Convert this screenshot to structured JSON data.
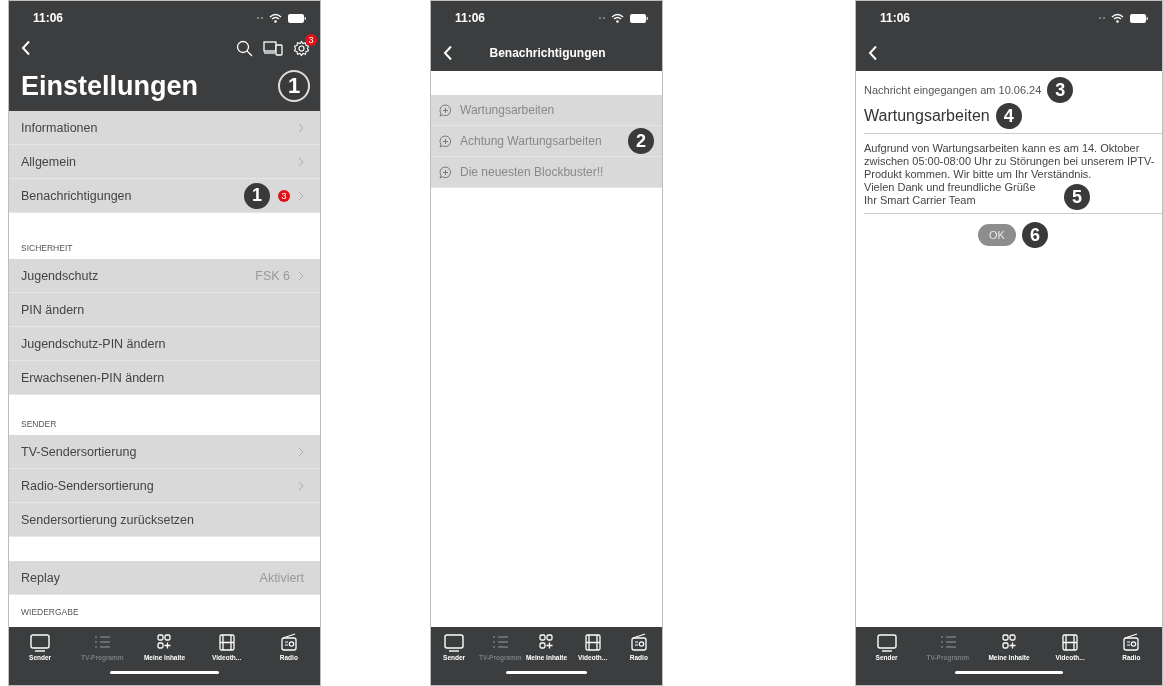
{
  "screens": [
    {
      "kind": "settings",
      "status_bar": {
        "time": "11:06"
      },
      "title": "Einstellungen",
      "title_callout": "1",
      "settings_badge": "3",
      "sections": [
        {
          "rows": [
            {
              "label": "Informationen",
              "chevron": true
            },
            {
              "label": "Allgemein",
              "chevron": true
            },
            {
              "label": "Benachrichtigungen",
              "badge": "3",
              "callout": "1",
              "chevron": true
            }
          ]
        },
        {
          "header": "SICHERHEIT",
          "rows": [
            {
              "label": "Jugendschutz",
              "value": "FSK 6",
              "chevron": true
            },
            {
              "label": "PIN ändern",
              "chevron": false
            },
            {
              "label": "Jugendschutz-PIN ändern",
              "chevron": false
            },
            {
              "label": "Erwachsenen-PIN ändern",
              "chevron": false
            }
          ]
        },
        {
          "header": "SENDER",
          "rows": [
            {
              "label": "TV-Sendersortierung",
              "chevron": true
            },
            {
              "label": "Radio-Sendersortierung",
              "chevron": true
            },
            {
              "label": "Sendersortierung zurücksetzen",
              "chevron": false
            }
          ]
        },
        {
          "rows": [
            {
              "label": "Replay",
              "value": "Aktiviert",
              "chevron": false
            }
          ]
        },
        {
          "header": "WIEDERGABE"
        }
      ],
      "tab_bar": [
        {
          "label": "Sender",
          "disabled": false
        },
        {
          "label": "TV-Programm",
          "disabled": true
        },
        {
          "label": "Meine Inhalte",
          "disabled": false
        },
        {
          "label": "Videoth...",
          "disabled": false
        },
        {
          "label": "Radio",
          "disabled": false
        }
      ]
    },
    {
      "kind": "notifications",
      "status_bar": {
        "time": "11:06"
      },
      "title": "Benachrichtigungen",
      "items": [
        {
          "label": "Wartungsarbeiten"
        },
        {
          "label": "Achtung Wartungsarbeiten",
          "callout": "2"
        },
        {
          "label": "Die neuesten Blockbuster!!"
        }
      ],
      "tab_bar": [
        {
          "label": "Sender",
          "disabled": false
        },
        {
          "label": "TV-Programm",
          "disabled": true
        },
        {
          "label": "Meine Inhalte",
          "disabled": false
        },
        {
          "label": "Videoth...",
          "disabled": false
        },
        {
          "label": "Radio",
          "disabled": false
        }
      ]
    },
    {
      "kind": "message",
      "status_bar": {
        "time": "11:06"
      },
      "received": "Nachricht eingegangen am 10.06.24",
      "received_callout": "3",
      "subject": "Wartungsarbeiten",
      "subject_callout": "4",
      "body": [
        "Aufgrund von Wartungsarbeiten kann es am 14. Oktober zwischen 05:00-08:00 Uhr zu Störungen bei unserem IPTV-Produkt kommen. Wir bitte um Ihr Verständnis.",
        "Vielen Dank und freundliche Grüße",
        "Ihr Smart Carrier Team"
      ],
      "body_callout": "5",
      "button": "OK",
      "button_callout": "6",
      "tab_bar": [
        {
          "label": "Sender",
          "disabled": false
        },
        {
          "label": "TV-Programm",
          "disabled": true
        },
        {
          "label": "Meine Inhalte",
          "disabled": false
        },
        {
          "label": "Videoth...",
          "disabled": false
        },
        {
          "label": "Radio",
          "disabled": false
        }
      ]
    }
  ]
}
